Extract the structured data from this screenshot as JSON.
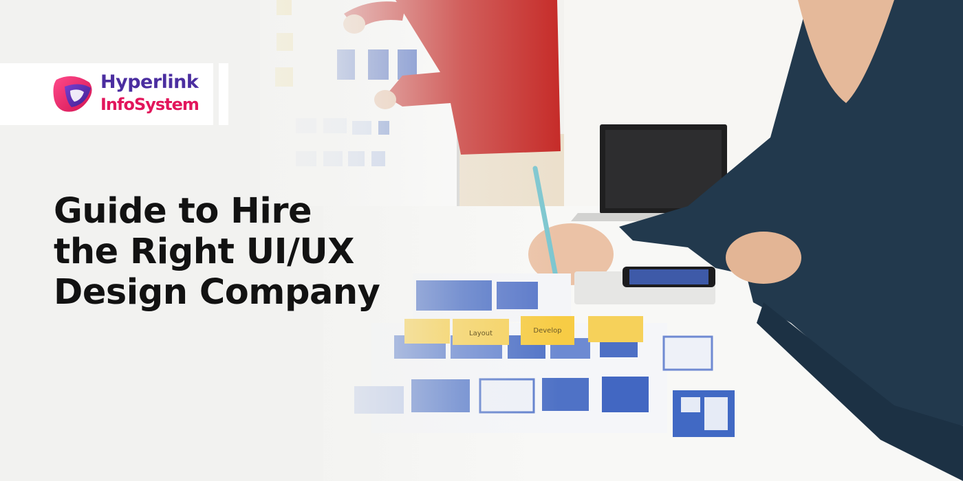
{
  "logo": {
    "line1": "Hyperlink",
    "line2": "InfoSystem",
    "colors": {
      "primary": "#4b2ea0",
      "accent": "#e2165c"
    }
  },
  "headline": {
    "lines": [
      "Guide to Hire",
      "the Right UI/UX",
      "Design Company"
    ]
  },
  "scene": {
    "sticky_notes": [
      "Layout",
      "Develop"
    ]
  }
}
